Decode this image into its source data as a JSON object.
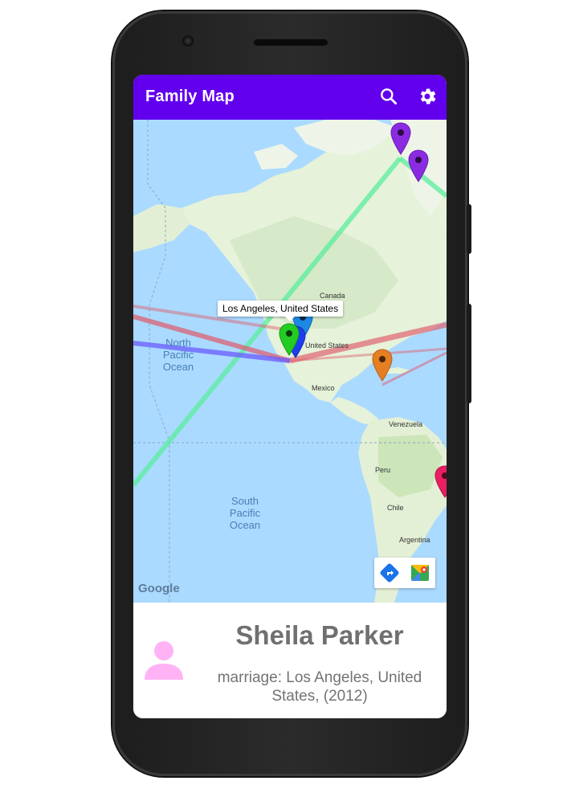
{
  "app": {
    "title": "Family Map"
  },
  "toolbar": {
    "search_icon": "search-icon",
    "settings_icon": "gear-icon"
  },
  "map": {
    "labels": {
      "canada": "Canada",
      "united_states": "United States",
      "mexico": "Mexico",
      "venezuela": "Venezuela",
      "peru": "Peru",
      "chile": "Chile",
      "argentina": "Argentina"
    },
    "oceans": {
      "north_pacific": "North Pacific Ocean",
      "south_pacific": "South Pacific Ocean"
    },
    "info_window": "Los Angeles, United States",
    "attribution": "Google",
    "marker_colors": {
      "violet": "#8a2be2",
      "azure": "#1e88e5",
      "blue": "#1f3df0",
      "green": "#22cc22",
      "orange": "#e67e22",
      "rose": "#e91e63"
    },
    "line_colors": {
      "spouse": "#e05a6a",
      "family": "#5aee9e",
      "life": "#6a5cff"
    }
  },
  "event_panel": {
    "person_name": "Sheila Parker",
    "event_description": "marriage: Los Angeles, United States, (2012)",
    "gender_icon_color": "#ffb3f5"
  }
}
